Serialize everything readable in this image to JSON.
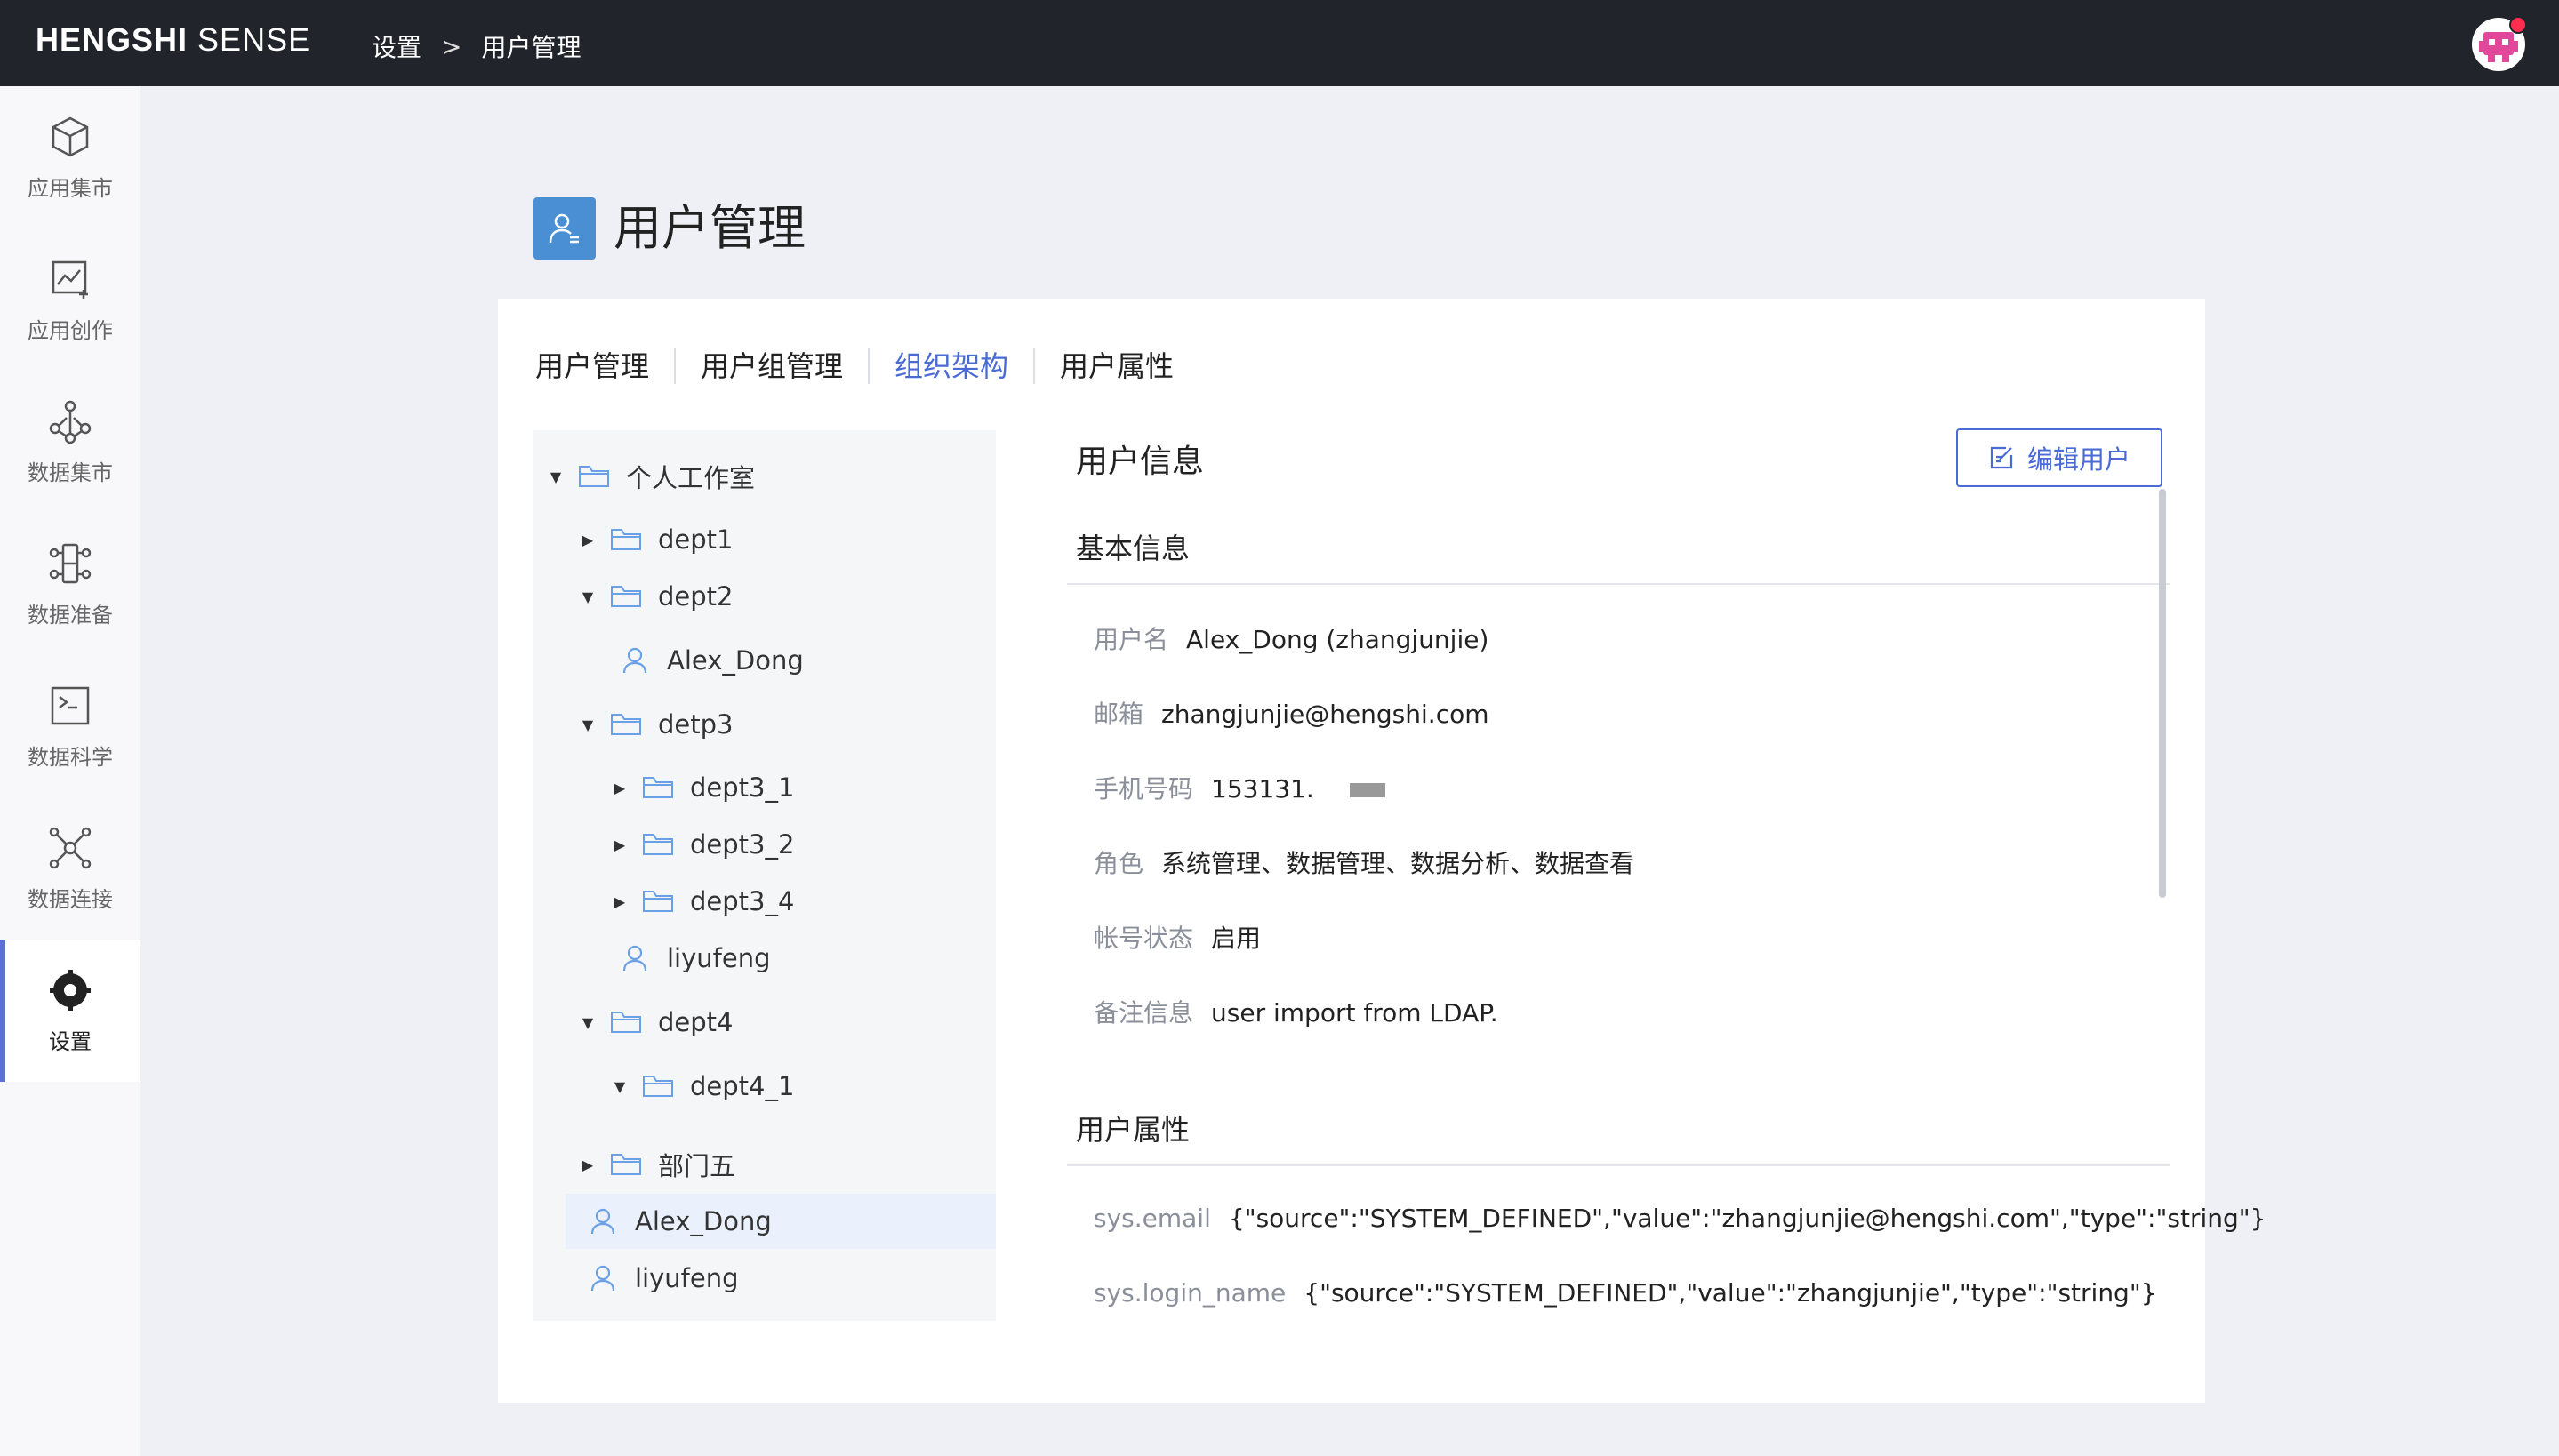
{
  "topbar": {
    "brand_bold": "HENGSHI",
    "brand_light": "SENSE",
    "breadcrumb": [
      "设置",
      "用户管理"
    ],
    "breadcrumb_sep": ">"
  },
  "sidebar": {
    "items": [
      {
        "label": "应用集市",
        "icon": "cube-icon"
      },
      {
        "label": "应用创作",
        "icon": "chart-edit-icon"
      },
      {
        "label": "数据集市",
        "icon": "dataset-network-icon"
      },
      {
        "label": "数据准备",
        "icon": "data-prep-icon"
      },
      {
        "label": "数据科学",
        "icon": "terminal-icon"
      },
      {
        "label": "数据连接",
        "icon": "connection-icon"
      },
      {
        "label": "设置",
        "icon": "gear-icon",
        "active": true
      }
    ]
  },
  "page": {
    "title": "用户管理"
  },
  "tabs": {
    "items": [
      "用户管理",
      "用户组管理",
      "组织架构",
      "用户属性"
    ],
    "active": "组织架构"
  },
  "tree": {
    "nodes": [
      {
        "label": "个人工作室",
        "type": "folder",
        "expanded": true
      },
      {
        "label": "dept1",
        "type": "folder",
        "expanded": false
      },
      {
        "label": "dept2",
        "type": "folder",
        "expanded": true
      },
      {
        "label": "Alex_Dong",
        "type": "user"
      },
      {
        "label": "detp3",
        "type": "folder",
        "expanded": true
      },
      {
        "label": "dept3_1",
        "type": "folder",
        "expanded": false
      },
      {
        "label": "dept3_2",
        "type": "folder",
        "expanded": false
      },
      {
        "label": "dept3_4",
        "type": "folder",
        "expanded": false
      },
      {
        "label": "liyufeng",
        "type": "user"
      },
      {
        "label": "dept4",
        "type": "folder",
        "expanded": true
      },
      {
        "label": "dept4_1",
        "type": "folder",
        "expanded": true
      },
      {
        "label": "部门五",
        "type": "folder",
        "expanded": false
      },
      {
        "label": "Alex_Dong",
        "type": "user",
        "selected": true
      },
      {
        "label": "liyufeng",
        "type": "user"
      }
    ]
  },
  "info": {
    "title": "用户信息",
    "edit_button": "编辑用户",
    "basic_section": "基本信息",
    "basic": {
      "username": {
        "key": "用户名",
        "value": "Alex_Dong (zhangjunjie)"
      },
      "email": {
        "key": "邮箱",
        "value": "zhangjunjie@hengshi.com"
      },
      "phone": {
        "key": "手机号码",
        "value": "153131."
      },
      "role": {
        "key": "角色",
        "value": "系统管理、数据管理、数据分析、数据查看"
      },
      "status": {
        "key": "帐号状态",
        "value": "启用"
      },
      "note": {
        "key": "备注信息",
        "value": "user import from LDAP."
      }
    },
    "attr_section": "用户属性",
    "attrs": [
      {
        "key": "sys.email",
        "value": "{\"source\":\"SYSTEM_DEFINED\",\"value\":\"zhangjunjie@hengshi.com\",\"type\":\"string\"}"
      },
      {
        "key": "sys.login_name",
        "value": "{\"source\":\"SYSTEM_DEFINED\",\"value\":\"zhangjunjie\",\"type\":\"string\"}"
      }
    ]
  },
  "colors": {
    "accent": "#4a6bd6",
    "topbar": "#22242b",
    "tree_icon": "#6aa0e6",
    "selected_row": "#eaf1fd"
  }
}
